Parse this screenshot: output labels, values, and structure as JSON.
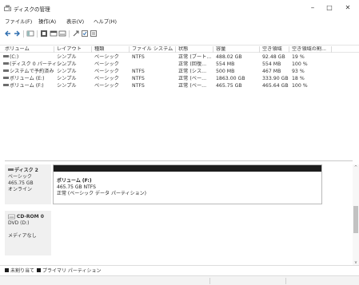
{
  "window": {
    "title": "ディスクの管理",
    "controls": {
      "minimize": "–",
      "maximize": "□",
      "close": "✕"
    }
  },
  "menu": [
    {
      "label": "ファイル(F)"
    },
    {
      "label": "操作(A)"
    },
    {
      "label": "表示(V)"
    },
    {
      "label": "ヘルプ(H)"
    }
  ],
  "toolbar": {
    "icons": [
      "back-icon",
      "forward-icon",
      "console-tree-icon",
      "help-icon",
      "properties-icon",
      "refresh-icon",
      "rescan-icon",
      "checkbox-icon",
      "list-icon"
    ]
  },
  "volumes": {
    "columns": [
      "ボリューム",
      "レイアウト",
      "種類",
      "ファイル システム",
      "状態",
      "容量",
      "空き領域",
      "空き領域の割..."
    ],
    "rows": [
      [
        "(C:)",
        "シンプル",
        "ベーシック",
        "NTFS",
        "正常 (ブート...",
        "488.02 GB",
        "92.48 GB",
        "19 %"
      ],
      [
        "(ディスク 0 パーティシ...",
        "シンプル",
        "ベーシック",
        "",
        "正常 (回復...",
        "554 MB",
        "554 MB",
        "100 %"
      ],
      [
        "システムで予約済み",
        "シンプル",
        "ベーシック",
        "NTFS",
        "正常 (シス...",
        "500 MB",
        "467 MB",
        "93 %"
      ],
      [
        "ボリューム (E:)",
        "シンプル",
        "ベーシック",
        "NTFS",
        "正常 (ベー...",
        "1863.00 GB",
        "333.90 GB",
        "18 %"
      ],
      [
        "ボリューム (F:)",
        "シンプル",
        "ベーシック",
        "NTFS",
        "正常 (ベー...",
        "465.75 GB",
        "465.64 GB",
        "100 %"
      ]
    ]
  },
  "disks": [
    {
      "name": "ディスク 2",
      "type": "ベーシック",
      "size": "465.75 GB",
      "status": "オンライン",
      "partition": {
        "name": "ボリューム (F:)",
        "size_fs": "465.75 GB NTFS",
        "status": "正常 (ベーシック データ パーティション)"
      }
    },
    {
      "name": "CD-ROM 0",
      "drive": "DVD (D:)",
      "media": "メディアなし"
    }
  ],
  "legend": [
    {
      "label": "未割り当て",
      "color": "#1d1d1d"
    },
    {
      "label": "プライマリ パーティション",
      "color": "#1d1d1d"
    }
  ]
}
